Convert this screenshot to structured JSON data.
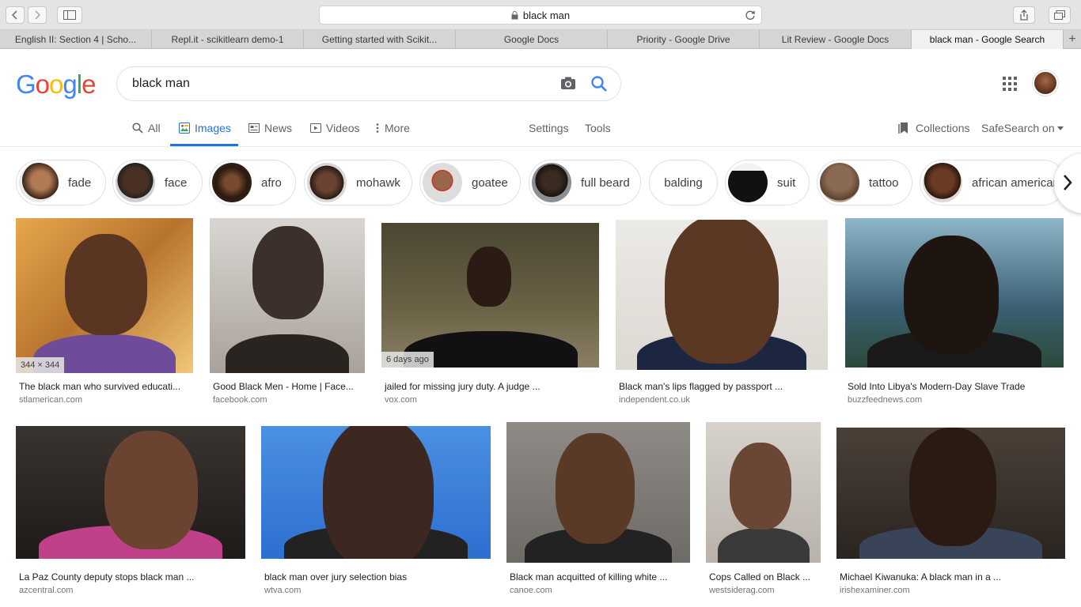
{
  "browser": {
    "address": "black man",
    "tabs": [
      {
        "label": "English II: Section 4 | Scho...",
        "active": false
      },
      {
        "label": "Repl.it - scikitlearn demo-1",
        "active": false
      },
      {
        "label": "Getting started with Scikit...",
        "active": false
      },
      {
        "label": "Google Docs",
        "active": false
      },
      {
        "label": "Priority - Google Drive",
        "active": false
      },
      {
        "label": "Lit Review - Google Docs",
        "active": false
      },
      {
        "label": "black man - Google Search",
        "active": true
      }
    ],
    "new_tab": "+"
  },
  "google": {
    "logo_letters": [
      {
        "ch": "G",
        "color": "#4285F4"
      },
      {
        "ch": "o",
        "color": "#EA4335"
      },
      {
        "ch": "o",
        "color": "#FBBC05"
      },
      {
        "ch": "g",
        "color": "#4285F4"
      },
      {
        "ch": "l",
        "color": "#34A853"
      },
      {
        "ch": "e",
        "color": "#EA4335"
      }
    ],
    "query": "black man"
  },
  "nav": {
    "all": "All",
    "images": "Images",
    "news": "News",
    "videos": "Videos",
    "more": "More",
    "settings": "Settings",
    "tools": "Tools",
    "collections": "Collections",
    "safesearch": "SafeSearch on"
  },
  "chips": [
    "fade",
    "face",
    "afro",
    "mohawk",
    "goatee",
    "full beard",
    "balding",
    "suit",
    "tattoo",
    "african american"
  ],
  "results_row1": [
    {
      "caption": "The black man who survived educati...",
      "source": "stlamerican.com",
      "badge": "344 × 344"
    },
    {
      "caption": "Good Black Men - Home | Face...",
      "source": "facebook.com",
      "badge": ""
    },
    {
      "caption": "jailed for missing jury duty. A judge ...",
      "source": "vox.com",
      "badge": "6 days ago"
    },
    {
      "caption": "Black man's lips flagged by passport ...",
      "source": "independent.co.uk",
      "badge": ""
    },
    {
      "caption": "Sold Into Libya's Modern-Day Slave Trade",
      "source": "buzzfeednews.com",
      "badge": ""
    }
  ],
  "results_row2": [
    {
      "caption": "La Paz County deputy stops black man ...",
      "source": "azcentral.com"
    },
    {
      "caption": "black man over jury selection bias",
      "source": "wtva.com"
    },
    {
      "caption": "Black man acquitted of killing white ...",
      "source": "canoe.com"
    },
    {
      "caption": "Cops Called on Black ...",
      "source": "westsiderag.com"
    },
    {
      "caption": "Michael Kiwanuka: A black man in a ...",
      "source": "irishexaminer.com"
    }
  ],
  "colors": {
    "accent": "#1a73e8",
    "caption": "#202124",
    "source": "#70757a"
  }
}
